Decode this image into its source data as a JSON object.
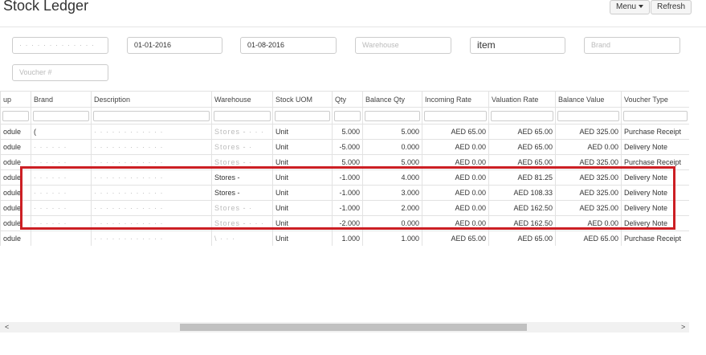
{
  "header": {
    "title": "Stock Ledger",
    "menu_label": "Menu",
    "refresh_label": "Refresh"
  },
  "filters": {
    "company": "· · · · · · · · · · · · ·",
    "from_date": "01-01-2016",
    "to_date": "01-08-2016",
    "warehouse_placeholder": "Warehouse",
    "item": "item",
    "brand_placeholder": "Brand",
    "voucher_placeholder": "Voucher #"
  },
  "columns": [
    "up",
    "Brand",
    "Description",
    "Warehouse",
    "Stock UOM",
    "Qty",
    "Balance Qty",
    "Incoming Rate",
    "Valuation Rate",
    "Balance Value",
    "Voucher Type"
  ],
  "rows": [
    [
      "odule",
      "(",
      "· · · · · · · · · · · ·",
      "Stores - · · ·",
      "Unit",
      "5.000",
      "5.000",
      "AED 65.00",
      "AED 65.00",
      "AED 325.00",
      "Purchase Receipt"
    ],
    [
      "odule",
      "· · · · · ·",
      "· · · · · · · · · · · ·",
      "Stores - ·",
      "Unit",
      "-5.000",
      "0.000",
      "AED 0.00",
      "AED 65.00",
      "AED 0.00",
      "Delivery Note"
    ],
    [
      "odule",
      "· · · · · ·",
      "· · · · · · · · · · · ·",
      "Stores - ·",
      "Unit",
      "5.000",
      "5.000",
      "AED 0.00",
      "AED 65.00",
      "AED 325.00",
      "Purchase Receipt"
    ],
    [
      "odule",
      "· · · · · ·",
      "· · · · · · · · · · · ·",
      "Stores -",
      "Unit",
      "-1.000",
      "4.000",
      "AED 0.00",
      "AED 81.25",
      "AED 325.00",
      "Delivery Note"
    ],
    [
      "odule",
      "· · · · · ·",
      "· · · · · · · · · · · ·",
      "Stores -",
      "Unit",
      "-1.000",
      "3.000",
      "AED 0.00",
      "AED 108.33",
      "AED 325.00",
      "Delivery Note"
    ],
    [
      "odule",
      "· · · · · ·",
      "· · · · · · · · · · · ·",
      "Stores - ·",
      "Unit",
      "-1.000",
      "2.000",
      "AED 0.00",
      "AED 162.50",
      "AED 325.00",
      "Delivery Note"
    ],
    [
      "odule",
      "· · · · · ·",
      "· · · · · · · · · · · ·",
      "Stores - · · ·",
      "Unit",
      "-2.000",
      "0.000",
      "AED 0.00",
      "AED 162.50",
      "AED 0.00",
      "Delivery Note"
    ],
    [
      "odule",
      "",
      "· · · · · · · · · · · ·",
      "\\ · · ·",
      "Unit",
      "1.000",
      "1.000",
      "AED 65.00",
      "AED 65.00",
      "AED 65.00",
      "Purchase Receipt"
    ]
  ],
  "scrollbar": {
    "left_arrow": "<",
    "right_arrow": ">"
  }
}
